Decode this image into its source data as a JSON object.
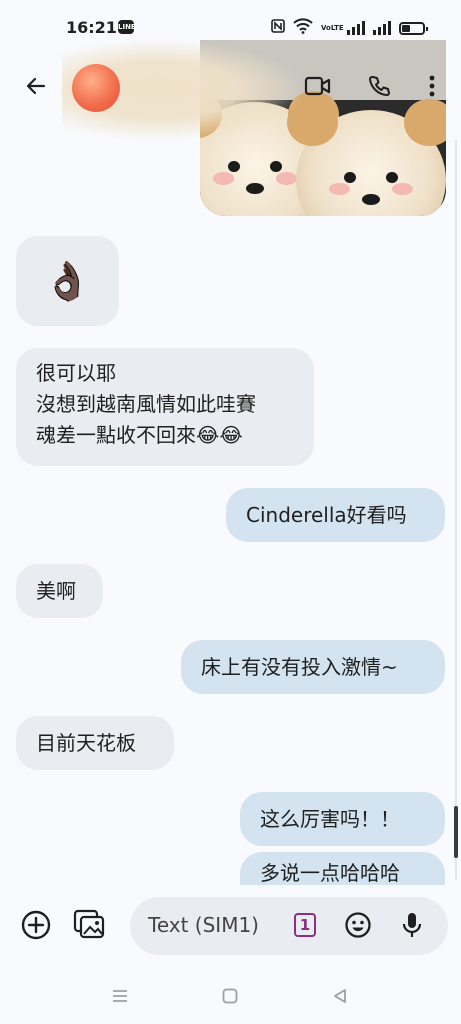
{
  "status_bar": {
    "time": "16:21",
    "line_badge": "LINE",
    "volte": "VoLTE",
    "icons": [
      "nfc-icon",
      "wifi-icon",
      "signal-icon",
      "signal-icon",
      "battery-icon"
    ]
  },
  "header": {
    "icons": [
      "back-arrow-icon",
      "avatar",
      "video-call-icon",
      "phone-icon",
      "more-vert-icon"
    ]
  },
  "messages": [
    {
      "direction": "in",
      "type": "emoji",
      "text": "👌🏿"
    },
    {
      "direction": "in",
      "type": "text",
      "lines": [
        "很可以耶",
        "沒想到越南風情如此哇賽",
        "魂差一點收不回來😂😂"
      ]
    },
    {
      "direction": "out",
      "type": "text",
      "text": "Cinderella好看吗"
    },
    {
      "direction": "in",
      "type": "text",
      "text": "美啊"
    },
    {
      "direction": "out",
      "type": "text",
      "text": "床上有没有投入激情~"
    },
    {
      "direction": "in",
      "type": "text",
      "text": "目前天花板"
    },
    {
      "direction": "out",
      "type": "text",
      "text": "这么厉害吗！！"
    },
    {
      "direction": "out",
      "type": "text",
      "text": "多说一点哈哈哈"
    }
  ],
  "composer": {
    "placeholder": "Text (SIM1)",
    "sim_badge": "1",
    "icons": [
      "add-icon",
      "gallery-icon",
      "emoji-icon",
      "mic-icon"
    ]
  },
  "navbar": {
    "icons": [
      "recents-icon",
      "home-icon",
      "back-triangle-icon"
    ]
  },
  "colors": {
    "background": "#f8fafd",
    "incoming_bubble": "#e9edf2",
    "outgoing_bubble": "#d3e3ef",
    "sim_badge": "#8b2f85"
  }
}
